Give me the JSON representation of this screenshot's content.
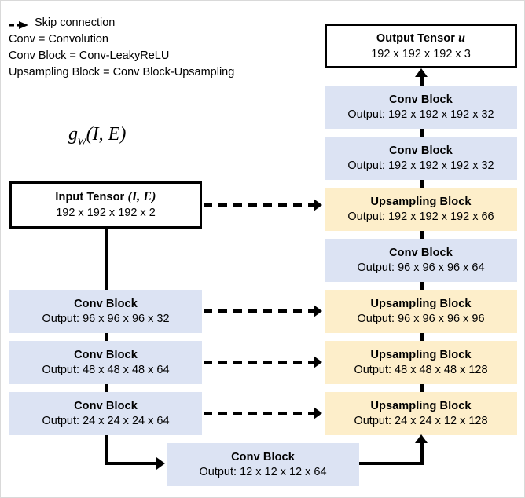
{
  "legend": {
    "items": [
      {
        "icon": "dashed-arrow-icon",
        "label": "Skip connection"
      },
      {
        "icon": "",
        "label": "Conv = Convolution"
      },
      {
        "icon": "",
        "label": "Conv Block = Conv-LeakyReLU"
      },
      {
        "icon": "",
        "label": "Upsampling Block = Conv Block-Upsampling"
      }
    ]
  },
  "formula": {
    "base": "g",
    "subscript": "w",
    "args": "(I, E)",
    "full": "g_w(I, E)"
  },
  "colors": {
    "conv_block_fill": "#dce3f3",
    "upsampling_block_fill": "#fdeeca",
    "tensor_border": "#000000",
    "page_border": "#d9d9d9",
    "background": "#ffffff"
  },
  "encoder": {
    "input_tensor": {
      "title": "Input Tensor (I, E)",
      "title_plain": "Input Tensor",
      "title_italic": "(I, E)",
      "shape": "192 x 192 x 192 x 2",
      "kind": "tensor"
    },
    "blocks": [
      {
        "title": "Conv Block",
        "shape": "Output: 96 x 96 x 96 x 32",
        "kind": "conv"
      },
      {
        "title": "Conv Block",
        "shape": "Output: 48 x 48 x 48 x 64",
        "kind": "conv"
      },
      {
        "title": "Conv Block",
        "shape": "Output: 24 x 24 x 24 x 64",
        "kind": "conv"
      }
    ]
  },
  "bottleneck": {
    "title": "Conv Block",
    "shape": "Output: 12 x 12 x 12 x 64",
    "kind": "conv"
  },
  "decoder": {
    "output_tensor": {
      "title": "Output Tensor u",
      "title_plain": "Output Tensor",
      "title_italic": "u",
      "shape": "192 x 192 x 192 x 3",
      "kind": "tensor"
    },
    "blocks": [
      {
        "title": "Conv Block",
        "shape": "Output: 192 x 192 x 192 x 32",
        "kind": "conv"
      },
      {
        "title": "Conv Block",
        "shape": "Output: 192 x 192 x 192 x 32",
        "kind": "conv"
      },
      {
        "title": "Upsampling Block",
        "shape": "Output: 192 x 192 x 192 x 66",
        "kind": "upsample"
      },
      {
        "title": "Conv Block",
        "shape": "Output: 96 x 96 x 96 x 64",
        "kind": "conv"
      },
      {
        "title": "Upsampling Block",
        "shape": "Output: 96 x 96 x 96 x 96",
        "kind": "upsample"
      },
      {
        "title": "Upsampling Block",
        "shape": "Output: 48 x 48 x 48 x 128",
        "kind": "upsample"
      },
      {
        "title": "Upsampling Block",
        "shape": "Output: 24 x 24 x 12 x 128",
        "kind": "upsample"
      }
    ]
  }
}
